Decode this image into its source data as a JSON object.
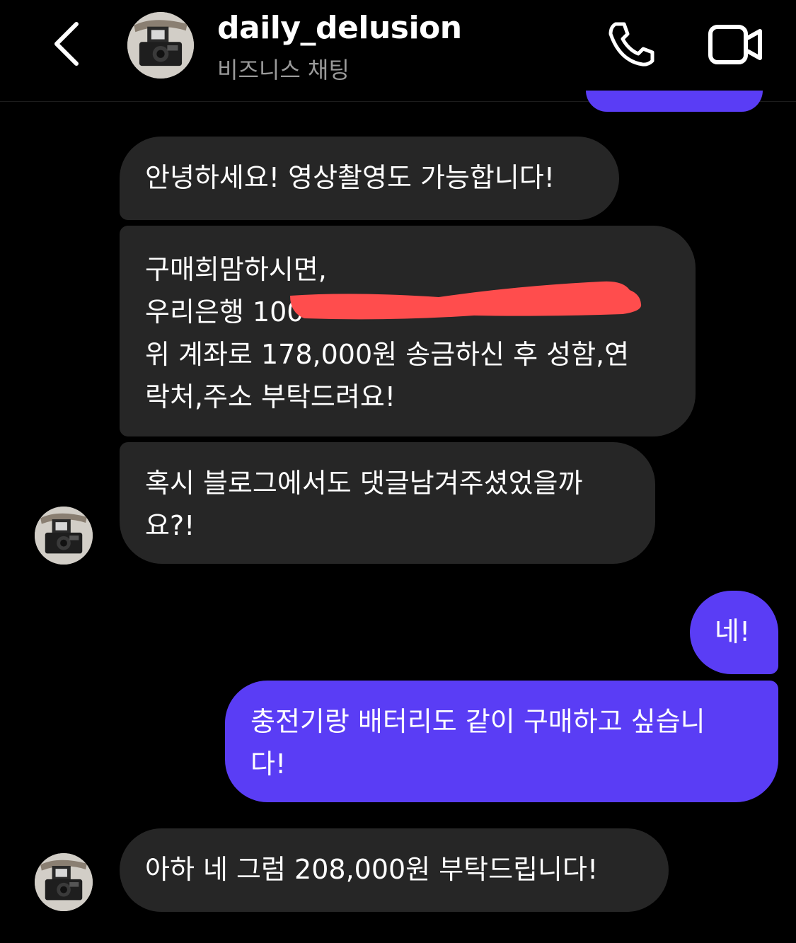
{
  "header": {
    "username": "daily_delusion",
    "subtitle": "비즈니스 채팅",
    "back_icon": "chevron-left-icon",
    "call_icon": "phone-icon",
    "video_icon": "video-camera-icon"
  },
  "messages": [
    {
      "sender": "them",
      "lines": [
        "안녕하세요! 영상촬영도 가능합니다!"
      ]
    },
    {
      "sender": "them",
      "lines": [
        "구매희맘하시면,",
        "우리은행 100",
        "위 계좌로 178,000원 송금하신 후 성함,연",
        "락처,주소 부탁드려요!"
      ],
      "redacted_line": 1
    },
    {
      "sender": "them",
      "lines": [
        "혹시 블로그에서도 댓글남겨주셨었을까",
        "요?!"
      ]
    },
    {
      "sender": "me",
      "lines": [
        "네!"
      ]
    },
    {
      "sender": "me",
      "lines": [
        "충전기랑 배터리도 같이 구매하고 싶습니",
        "다!"
      ]
    },
    {
      "sender": "them",
      "lines": [
        "아하 네 그럼 208,000원 부탁드립니다!"
      ]
    }
  ],
  "colors": {
    "background": "#000000",
    "incoming_bubble": "#262626",
    "outgoing_bubble": "#5a3df5",
    "subtitle": "#9a9a9a",
    "redaction": "#ff4d4d"
  }
}
